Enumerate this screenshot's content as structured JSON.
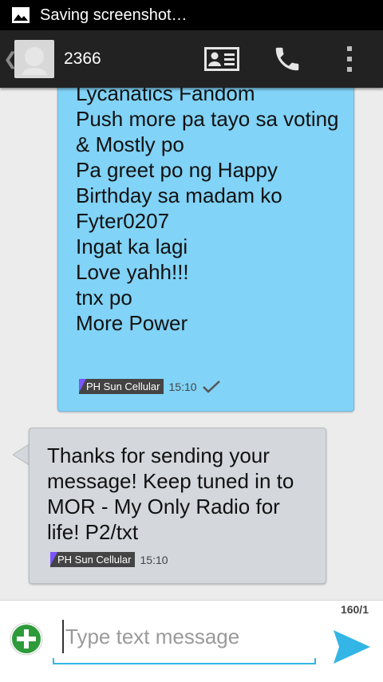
{
  "statusbar": {
    "text": "Saving screenshot…",
    "icon": "image-icon"
  },
  "actionbar": {
    "back_icon": "chevron-left-icon",
    "back_glyph": "❮",
    "contact_name": "2366",
    "buttons": [
      "contact-card-icon",
      "phone-icon",
      "overflow-menu-icon"
    ]
  },
  "messages": [
    {
      "direction": "outgoing",
      "text": "Lycanatics Fandom\nPush more pa tayo sa voting\n& Mostly po\nPa greet po ng Happy Birthday sa madam ko\nFyter0207\nIngat ka lagi\nLove yahh!!!\ntnx po\nMore Power",
      "carrier": "PH Sun Cellular",
      "time": "15:10",
      "status": "sent",
      "color": "#81d3f7"
    },
    {
      "direction": "incoming",
      "text": "Thanks for sending your message! Keep tuned in to MOR - My Only Radio for life! P2/txt",
      "carrier": "PH Sun Cellular",
      "time": "15:10",
      "color": "#d4d7dc"
    }
  ],
  "compose": {
    "counter": "160/1",
    "placeholder": "Type text message",
    "value": ""
  },
  "colors": {
    "accent": "#33b5e5",
    "attach": "#2e9b3a",
    "carrier_flag": "#7b55ff"
  }
}
